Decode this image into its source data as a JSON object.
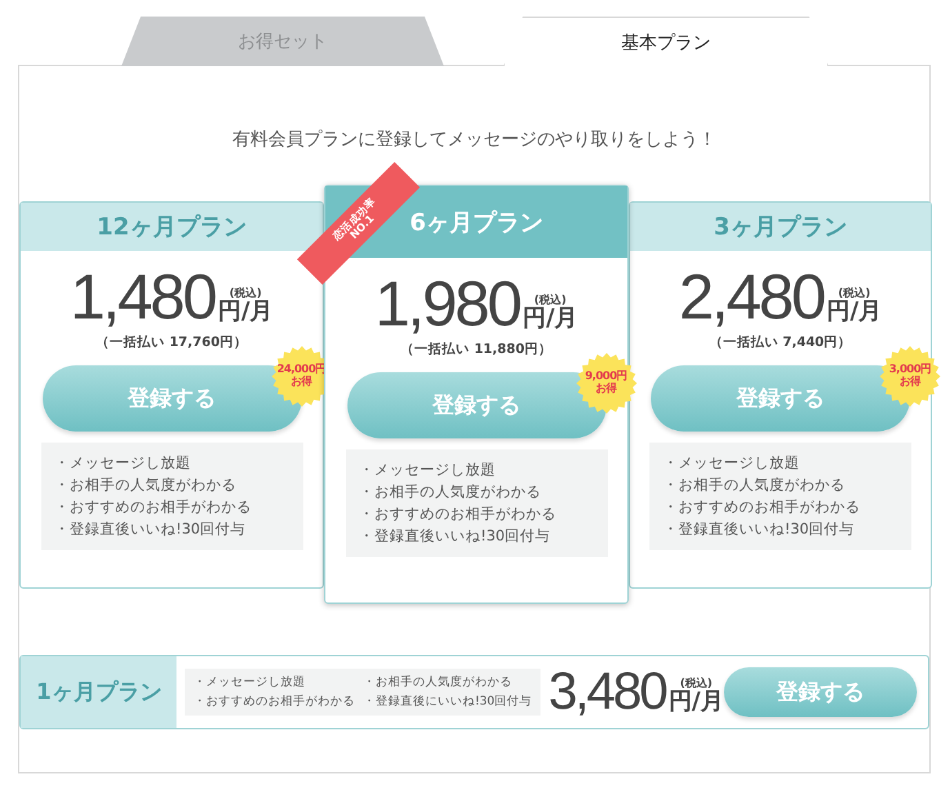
{
  "tabs": [
    {
      "label": "お得セット",
      "selected": false
    },
    {
      "label": "基本プラン",
      "selected": true
    }
  ],
  "intro": "有料会員プランに登録してメッセージのやり取りをしよう！",
  "plans": [
    {
      "title": "12ヶ月プラン",
      "featured": false,
      "amount": "1,480",
      "tax": "(税込)",
      "unit": "円/月",
      "lump": "（一括払い 17,760円）",
      "button": "登録する",
      "badge": [
        "24,000円",
        "お得"
      ],
      "features": [
        "・メッセージし放題",
        "・お相手の人気度がわかる",
        "・おすすめのお相手がわかる",
        "・登録直後いいね!30回付与"
      ]
    },
    {
      "title": "6ヶ月プラン",
      "featured": true,
      "ribbon": [
        "恋活成功率",
        "NO.1"
      ],
      "amount": "1,980",
      "tax": "(税込)",
      "unit": "円/月",
      "lump": "（一括払い 11,880円）",
      "button": "登録する",
      "badge": [
        "9,000円",
        "お得"
      ],
      "features": [
        "・メッセージし放題",
        "・お相手の人気度がわかる",
        "・おすすめのお相手がわかる",
        "・登録直後いいね!30回付与"
      ]
    },
    {
      "title": "3ヶ月プラン",
      "featured": false,
      "amount": "2,480",
      "tax": "(税込)",
      "unit": "円/月",
      "lump": "（一括払い 7,440円）",
      "button": "登録する",
      "badge": [
        "3,000円",
        "お得"
      ],
      "features": [
        "・メッセージし放題",
        "・お相手の人気度がわかる",
        "・おすすめのお相手がわかる",
        "・登録直後いいね!30回付与"
      ]
    }
  ],
  "monthly": {
    "title": "1ヶ月プラン",
    "features": [
      "・メッセージし放題",
      "・お相手の人気度がわかる",
      "・おすすめのお相手がわかる",
      "・登録直後にいいね!30回付与"
    ],
    "amount": "3,480",
    "tax": "(税込)",
    "unit": "円/月",
    "button": "登録する"
  }
}
